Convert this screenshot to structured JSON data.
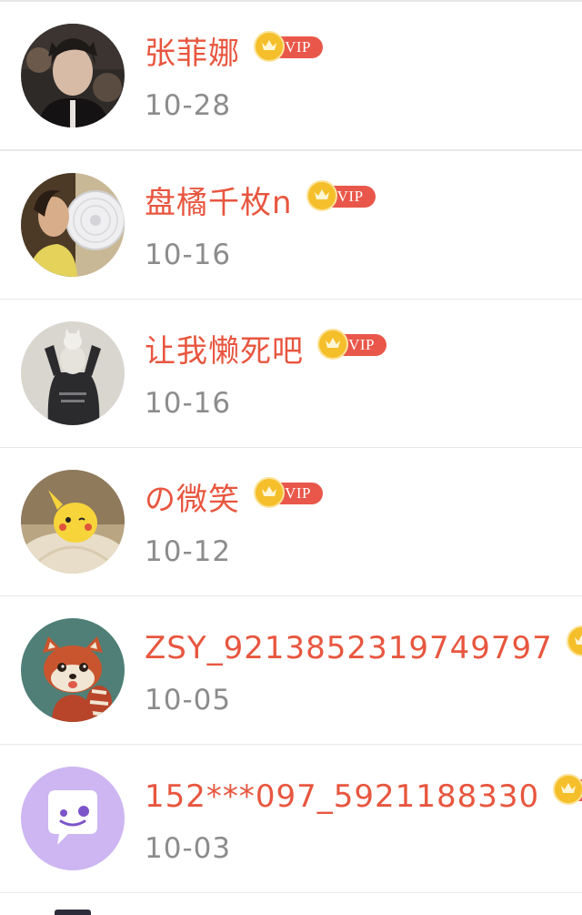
{
  "vip_label": "VIP",
  "users": [
    {
      "name": "张菲娜",
      "date": "10-28",
      "vip": true
    },
    {
      "name": "盘橘千枚n",
      "date": "10-16",
      "vip": true
    },
    {
      "name": "让我懒死吧",
      "date": "10-16",
      "vip": true
    },
    {
      "name": "の微笑",
      "date": "10-12",
      "vip": true
    },
    {
      "name": "ZSY_9213852319749797",
      "date": "10-05",
      "vip": true
    },
    {
      "name": "152***097_5921188330",
      "date": "10-03",
      "vip": true
    }
  ],
  "colors": {
    "name": "#e8563f",
    "date": "#8c8c8c",
    "vip_badge": "#e9574a",
    "crown": "#f5bf2b",
    "divider": "#e9e9e9"
  }
}
